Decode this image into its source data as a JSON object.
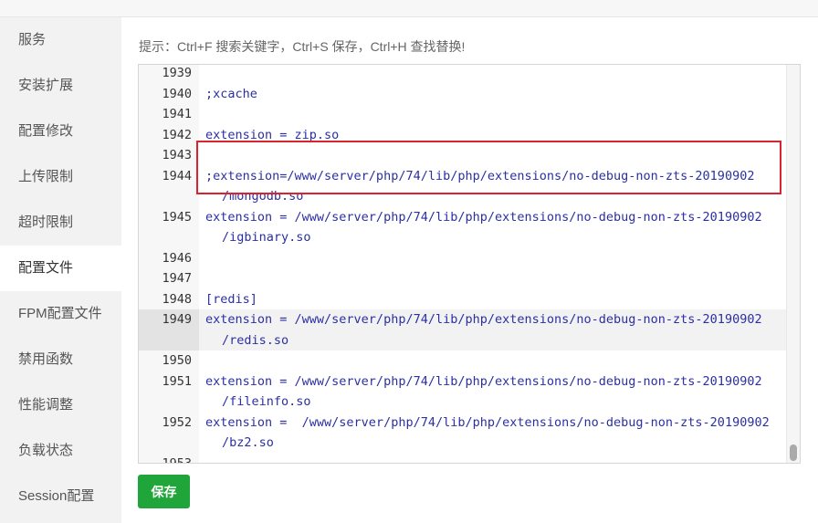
{
  "sidebar": {
    "items": [
      {
        "label": "服务"
      },
      {
        "label": "安装扩展"
      },
      {
        "label": "配置修改"
      },
      {
        "label": "上传限制"
      },
      {
        "label": "超时限制"
      },
      {
        "label": "配置文件",
        "active": true
      },
      {
        "label": "FPM配置文件"
      },
      {
        "label": "禁用函数"
      },
      {
        "label": "性能调整"
      },
      {
        "label": "负载状态"
      },
      {
        "label": "Session配置"
      }
    ]
  },
  "hint": "提示：Ctrl+F 搜索关键字，Ctrl+S 保存，Ctrl+H 查找替换!",
  "editor": {
    "lines": [
      {
        "num": "1939",
        "text": ""
      },
      {
        "num": "1940",
        "text": ";xcache"
      },
      {
        "num": "1941",
        "text": ""
      },
      {
        "num": "1942",
        "text": "extension = zip.so"
      },
      {
        "num": "1943",
        "text": ""
      },
      {
        "num": "1944",
        "text": ";extension=/www/server/php/74/lib/php/extensions/no-debug-non-zts-20190902",
        "cont": "/mongodb.so"
      },
      {
        "num": "1945",
        "text": "extension = /www/server/php/74/lib/php/extensions/no-debug-non-zts-20190902",
        "cont": "/igbinary.so"
      },
      {
        "num": "1946",
        "text": ""
      },
      {
        "num": "1947",
        "text": ""
      },
      {
        "num": "1948",
        "text": "[redis]"
      },
      {
        "num": "1949",
        "text": "extension = /www/server/php/74/lib/php/extensions/no-debug-non-zts-20190902",
        "cont": "/redis.so",
        "active": true
      },
      {
        "num": "1950",
        "text": ""
      },
      {
        "num": "1951",
        "text": "extension = /www/server/php/74/lib/php/extensions/no-debug-non-zts-20190902",
        "cont": "/fileinfo.so"
      },
      {
        "num": "1952",
        "text": "extension =  /www/server/php/74/lib/php/extensions/no-debug-non-zts-20190902",
        "cont": "/bz2.so"
      },
      {
        "num": "1953",
        "text": ""
      }
    ]
  },
  "save_label": "保存",
  "colors": {
    "accent": "#20a53a",
    "highlight": "#d9232d",
    "code_text": "#2b2fa3"
  }
}
